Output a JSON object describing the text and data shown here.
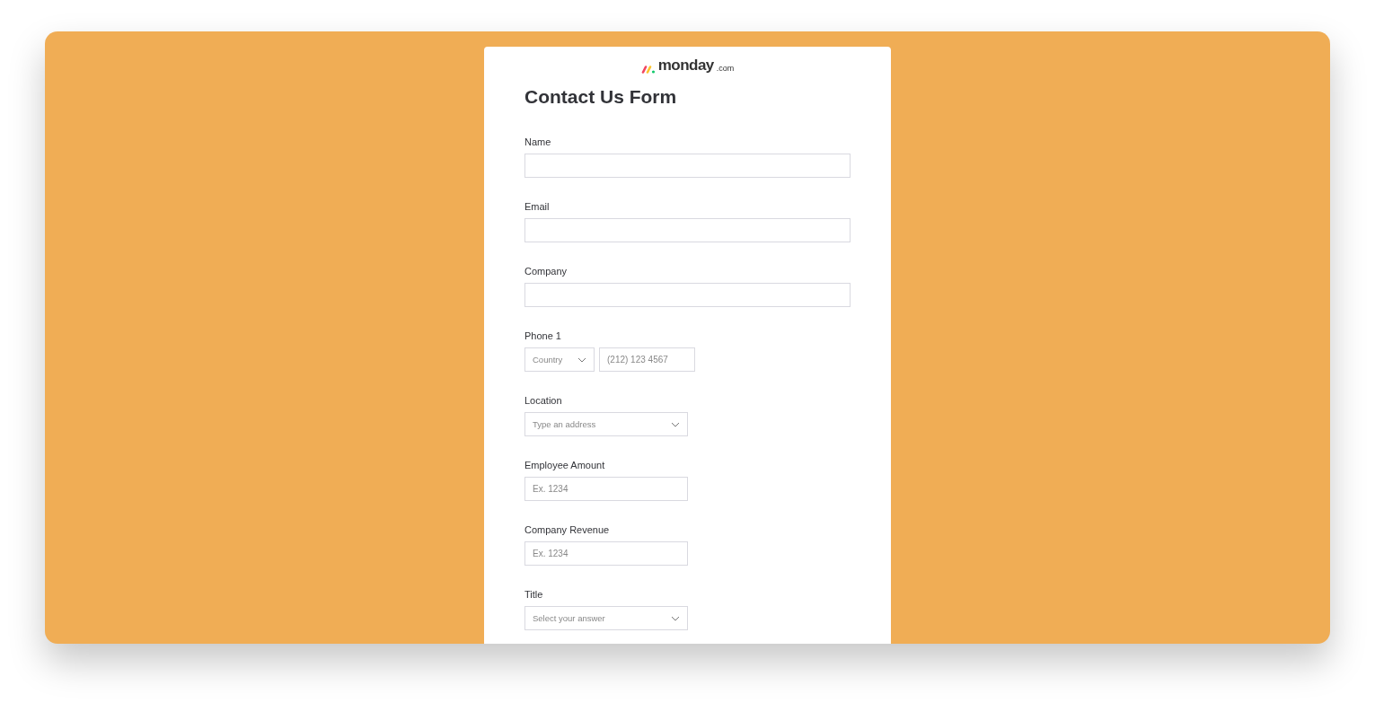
{
  "logo": {
    "name": "monday",
    "suffix": ".com"
  },
  "form": {
    "title": "Contact Us Form",
    "fields": [
      {
        "kind": "text",
        "label": "Name"
      },
      {
        "kind": "text",
        "label": "Email"
      },
      {
        "kind": "text",
        "label": "Company"
      },
      {
        "kind": "phone",
        "label": "Phone 1",
        "country_placeholder": "Country",
        "placeholder": "(212) 123 4567"
      },
      {
        "kind": "select",
        "label": "Location",
        "placeholder": "Type an address"
      },
      {
        "kind": "number",
        "label": "Employee Amount",
        "placeholder": "Ex. 1234"
      },
      {
        "kind": "number",
        "label": "Company Revenue",
        "placeholder": "Ex. 1234"
      },
      {
        "kind": "select",
        "label": "Title",
        "placeholder": "Select your answer"
      }
    ]
  }
}
